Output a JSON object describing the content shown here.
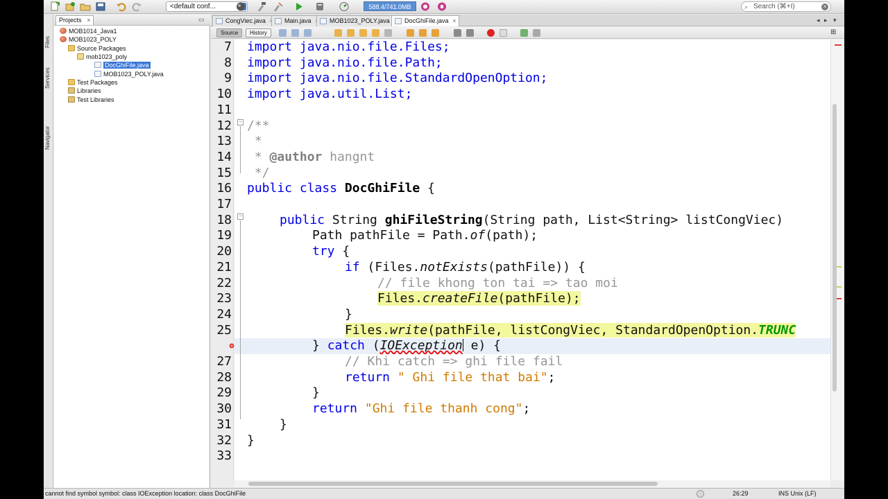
{
  "toolbar": {
    "config": "<default conf...",
    "memory": "588.4/741.0MB",
    "search_placeholder": "Search (⌘+I)"
  },
  "side_tabs": [
    "Files",
    "Services",
    "Navigator"
  ],
  "projects": {
    "tab_label": "Projects",
    "items": [
      {
        "label": "MOB1014_Java1"
      },
      {
        "label": "MOB1023_POLY"
      },
      {
        "label": "Source Packages"
      },
      {
        "label": "mob1023_poly"
      },
      {
        "label": "DocGhiFile.java"
      },
      {
        "label": "MOB1023_POLY.java"
      },
      {
        "label": "Test Packages"
      },
      {
        "label": "Libraries"
      },
      {
        "label": "Test Libraries"
      }
    ]
  },
  "editor": {
    "tabs": [
      {
        "label": "CongViec.java"
      },
      {
        "label": "Main.java"
      },
      {
        "label": "MOB1023_POLY.java"
      },
      {
        "label": "DocGhiFile.java"
      }
    ],
    "source_label": "Source",
    "history_label": "History",
    "line_numbers": [
      "7",
      "8",
      "9",
      "10",
      "11",
      "12",
      "13",
      "14",
      "15",
      "16",
      "17",
      "18",
      "19",
      "20",
      "21",
      "22",
      "23",
      "24",
      "25",
      "",
      "27",
      "28",
      "29",
      "30",
      "31",
      "32",
      "33"
    ],
    "code": {
      "l7": "import java.nio.file.Files;",
      "l8": "import java.nio.file.Path;",
      "l9": "import java.nio.file.StandardOpenOption;",
      "l10": "import java.util.List;",
      "l12": "/**",
      "l13": " *",
      "l14_tag": "@author",
      "l14_name": " hangnt",
      "l15": " */",
      "l16_a": "public class ",
      "l16_b": "DocGhiFile",
      "l16_c": " {",
      "l18_a": "public",
      "l18_b": " String ",
      "l18_c": "ghiFileString",
      "l18_d": "(String path, List<String> listCongViec)",
      "l19_a": "Path pathFile = Path.",
      "l19_b": "of",
      "l19_c": "(path);",
      "l20_a": "try",
      "l20_b": " {",
      "l21_a": "if",
      "l21_b": " (Files.",
      "l21_c": "notExists",
      "l21_d": "(pathFile)) {",
      "l22": "// file khong ton tai => tao moi",
      "l23_a": "Files.",
      "l23_b": "createFile",
      "l23_c": "(pathFile);",
      "l24": "}",
      "l25_a": "Files.",
      "l25_b": "write",
      "l25_c": "(pathFile, listCongViec, StandardOpenOption.",
      "l25_d": "TRUNC",
      "l26_a": "} ",
      "l26_b": "catch",
      "l26_c": " (",
      "l26_d": "IOException",
      "l26_e": " e) {",
      "l27": "// Khi catch => ghi file fail",
      "l28_a": "return",
      "l28_b": "\" Ghi file that bai\"",
      "l28_c": ";",
      "l29": "}",
      "l30_a": "return",
      "l30_b": "\"Ghi file thanh cong\"",
      "l30_c": ";",
      "l31": "}",
      "l32": "}"
    }
  },
  "status": {
    "message": "cannot find symbol   symbol:   class IOException   location: class DocGhiFile",
    "position": "26:29",
    "mode": "INS Unix (LF)"
  }
}
